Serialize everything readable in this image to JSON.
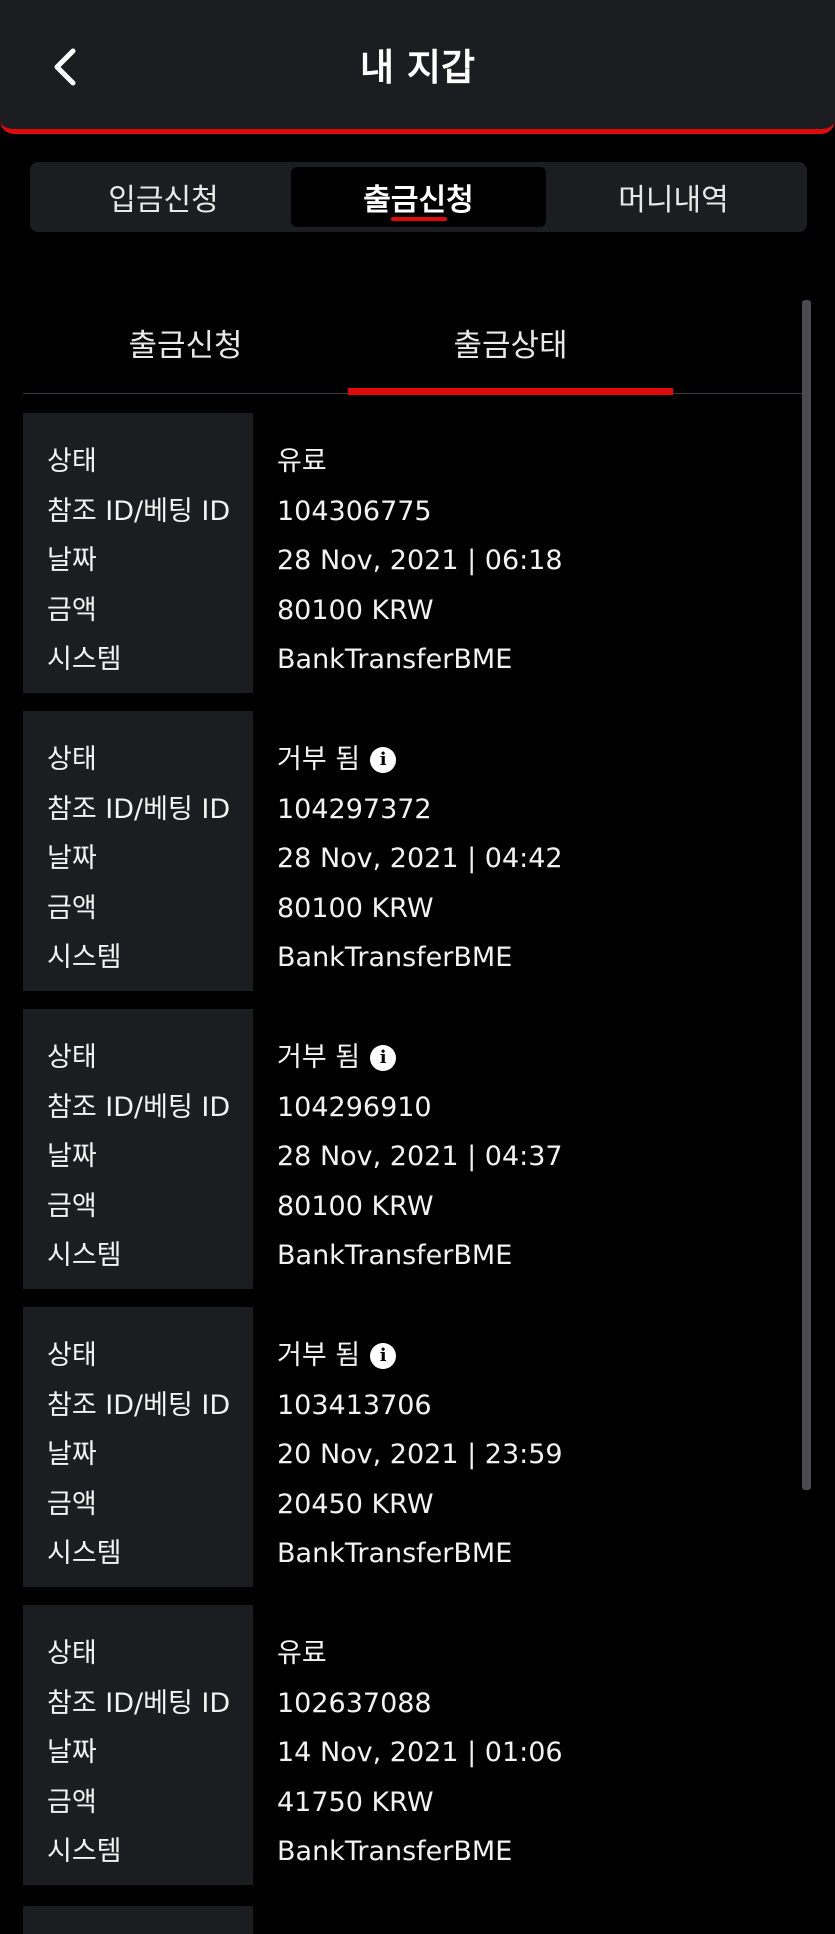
{
  "header": {
    "title": "내 지갑"
  },
  "top_tabs": [
    {
      "label": "입금신청",
      "active": false
    },
    {
      "label": "출금신청",
      "active": true
    },
    {
      "label": "머니내역",
      "active": false
    }
  ],
  "sub_tabs": [
    {
      "label": "출금신청",
      "active": false
    },
    {
      "label": "출금상태",
      "active": true
    }
  ],
  "field_labels": {
    "status": "상태",
    "ref_id": "참조 ID/베팅 ID",
    "date": "날짜",
    "amount": "금액",
    "system": "시스템"
  },
  "records": [
    {
      "status": "유료",
      "info_icon": false,
      "ref_id": "104306775",
      "date": "28 Nov, 2021 | 06:18",
      "amount": "80100 KRW",
      "system": "BankTransferBME"
    },
    {
      "status": "거부 됨",
      "info_icon": true,
      "ref_id": "104297372",
      "date": "28 Nov, 2021 | 04:42",
      "amount": "80100 KRW",
      "system": "BankTransferBME"
    },
    {
      "status": "거부 됨",
      "info_icon": true,
      "ref_id": "104296910",
      "date": "28 Nov, 2021 | 04:37",
      "amount": "80100 KRW",
      "system": "BankTransferBME"
    },
    {
      "status": "거부 됨",
      "info_icon": true,
      "ref_id": "103413706",
      "date": "20 Nov, 2021 | 23:59",
      "amount": "20450 KRW",
      "system": "BankTransferBME"
    },
    {
      "status": "유료",
      "info_icon": false,
      "ref_id": "102637088",
      "date": "14 Nov, 2021 | 01:06",
      "amount": "41750 KRW",
      "system": "BankTransferBME"
    }
  ],
  "colors": {
    "accent": "#e00a0a",
    "panel": "#1c1d21",
    "background": "#000000"
  }
}
